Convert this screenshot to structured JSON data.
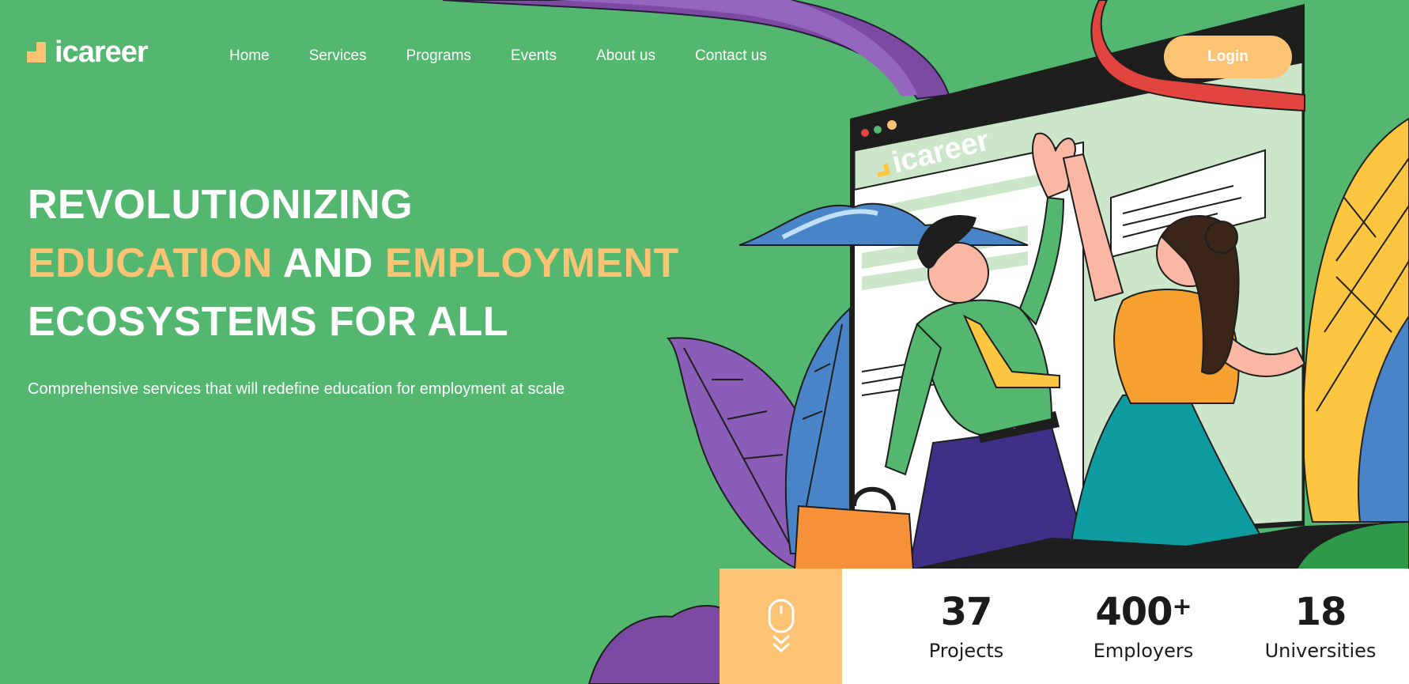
{
  "brand": {
    "name": "icareer",
    "screen_logo": "icareer"
  },
  "nav": {
    "items": [
      "Home",
      "Services",
      "Programs",
      "Events",
      "About us",
      "Contact us"
    ]
  },
  "header": {
    "login_label": "Login"
  },
  "hero": {
    "line1": "REVOLUTIONIZING",
    "line2_accent1": "EDUCATION",
    "line2_plain": " AND ",
    "line2_accent2": "EMPLOYMENT",
    "line3": "ECOSYSTEMS FOR ALL",
    "subtitle": "Comprehensive services that will redefine education for employment at scale"
  },
  "stats": [
    {
      "value": "37",
      "suffix": "",
      "label": "Projects"
    },
    {
      "value": "400",
      "suffix": "+",
      "label": "Employers"
    },
    {
      "value": "18",
      "suffix": "",
      "label": "Universities"
    }
  ],
  "icons": {
    "scroll": "mouse-scroll-icon",
    "logo": "logo-mark-icon"
  },
  "colors": {
    "background": "#53b76f",
    "accent": "#fcc374",
    "purple": "#7c4aa3",
    "red": "#e2453f"
  }
}
